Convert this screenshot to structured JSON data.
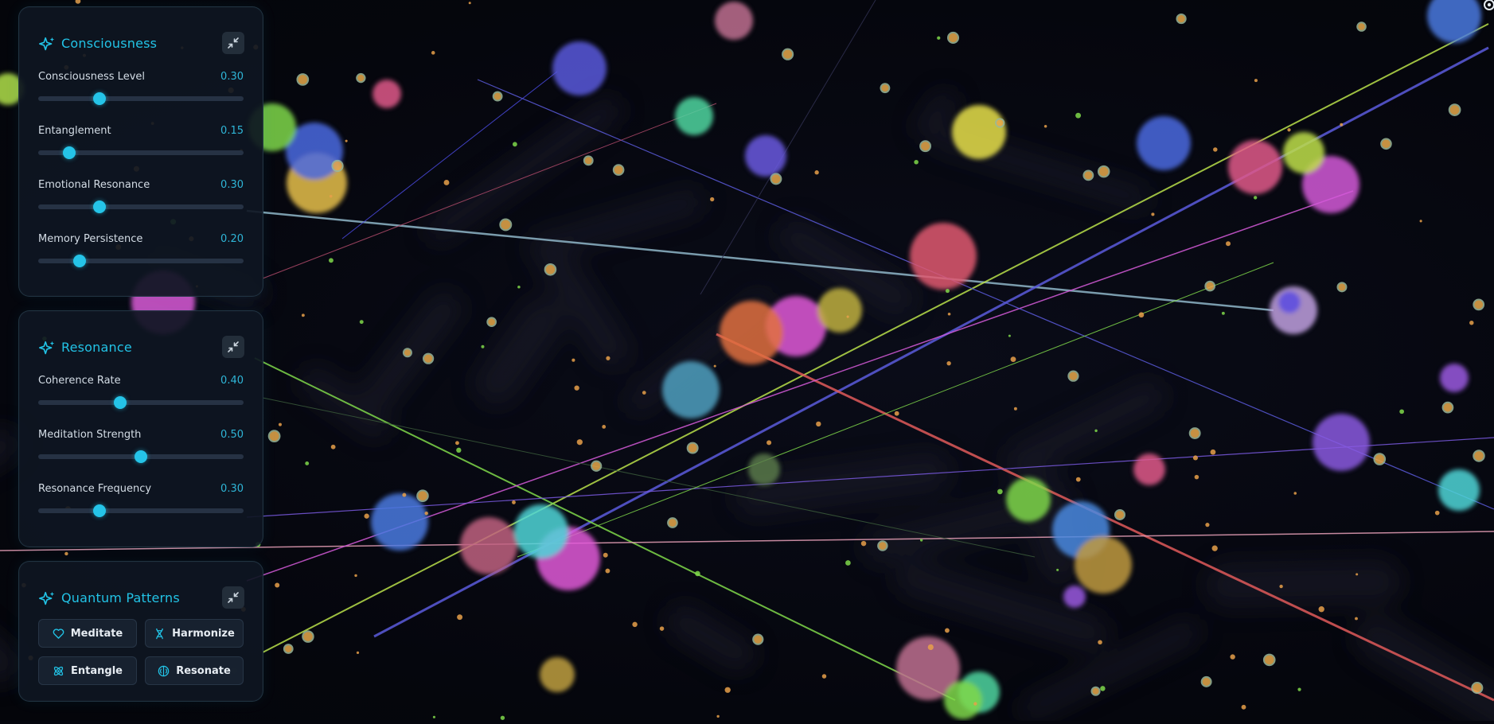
{
  "panels": {
    "consciousness": {
      "title": "Consciousness",
      "sliders": [
        {
          "label": "Consciousness Level",
          "value": "0.30",
          "fraction": 0.3
        },
        {
          "label": "Entanglement",
          "value": "0.15",
          "fraction": 0.15
        },
        {
          "label": "Emotional Resonance",
          "value": "0.30",
          "fraction": 0.3
        },
        {
          "label": "Memory Persistence",
          "value": "0.20",
          "fraction": 0.2
        }
      ]
    },
    "resonance": {
      "title": "Resonance",
      "sliders": [
        {
          "label": "Coherence Rate",
          "value": "0.40",
          "fraction": 0.4
        },
        {
          "label": "Meditation Strength",
          "value": "0.50",
          "fraction": 0.5
        },
        {
          "label": "Resonance Frequency",
          "value": "0.30",
          "fraction": 0.3
        }
      ]
    },
    "patterns": {
      "title": "Quantum Patterns",
      "buttons": [
        {
          "label": "Meditate",
          "icon": "heart-icon"
        },
        {
          "label": "Harmonize",
          "icon": "dna-icon"
        },
        {
          "label": "Entangle",
          "icon": "atom-icon"
        },
        {
          "label": "Resonate",
          "icon": "brain-icon"
        }
      ]
    }
  },
  "colors": {
    "accent": "#22c3e6",
    "background": "#05060d",
    "panel": "#0e1622"
  }
}
